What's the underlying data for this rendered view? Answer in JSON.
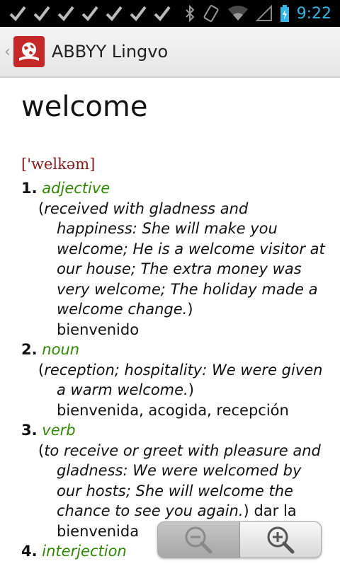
{
  "status_bar": {
    "time": "9:22",
    "icons": [
      "check-icon",
      "check-icon",
      "check-icon",
      "check-icon",
      "check-icon",
      "check-icon",
      "check-icon",
      "bluetooth-icon",
      "vibrate-icon",
      "wifi-icon",
      "signal-icon",
      "battery-charging-icon"
    ],
    "time_color": "#33b5e5"
  },
  "action_bar": {
    "title": "ABBYY Lingvo",
    "logo_color": "#c62828"
  },
  "entry": {
    "headword": "welcome",
    "transcription": "['welkəm]",
    "senses": [
      {
        "num": "1.",
        "pos": "adjective",
        "gloss_open": "(",
        "gloss": "received with gladness and happiness: She will make you welcome; He is a welcome visitor at our house; The extra money was very welcome; The holiday made a welcome change.",
        "gloss_close": ")",
        "translation": "bienvenido"
      },
      {
        "num": "2.",
        "pos": "noun",
        "gloss_open": "(",
        "gloss": "reception; hospitality: We were given a warm welcome.",
        "gloss_close": ")",
        "translation": "bienvenida, acogida, recepción"
      },
      {
        "num": "3.",
        "pos": "verb",
        "gloss_open": "(",
        "gloss": "to receive or greet with pleasure and gladness: We were welcomed by our hosts; She will welcome the chance to see you again.",
        "gloss_close": ")",
        "translation": "dar la bienvenida"
      },
      {
        "num": "4.",
        "pos": "interjection"
      }
    ]
  },
  "colors": {
    "pos": "#2e8b00",
    "transcription": "#8b1a1a"
  },
  "zoom": {
    "out_icon": "zoom-out-icon",
    "in_icon": "zoom-in-icon"
  }
}
